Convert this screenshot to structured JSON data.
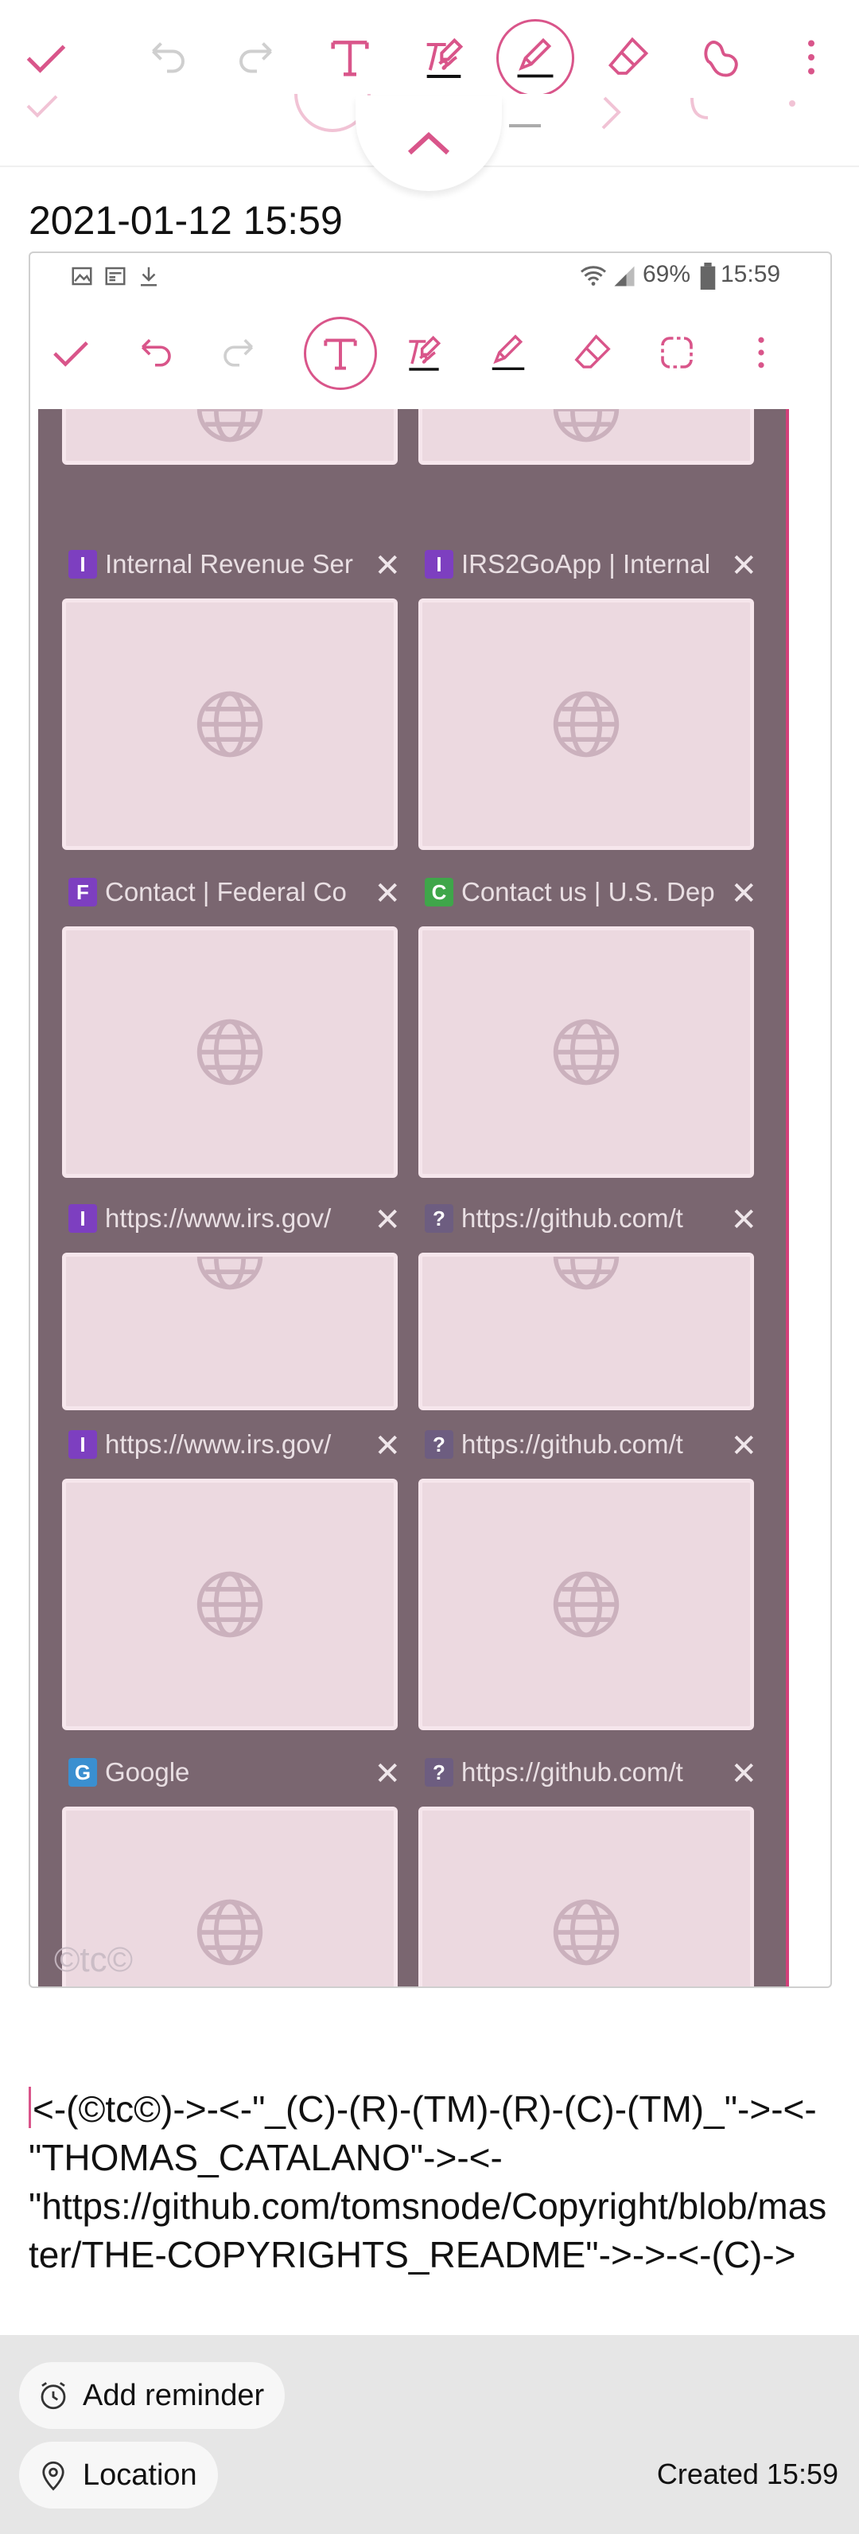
{
  "toolbar": {
    "buttons": [
      {
        "name": "done",
        "icon": "check-icon"
      },
      {
        "name": "undo",
        "icon": "undo-icon"
      },
      {
        "name": "redo",
        "icon": "redo-icon"
      },
      {
        "name": "text",
        "icon": "text-icon"
      },
      {
        "name": "handwriting",
        "icon": "handwriting-icon"
      },
      {
        "name": "pen",
        "icon": "pen-icon",
        "active": true
      },
      {
        "name": "eraser",
        "icon": "eraser-icon"
      },
      {
        "name": "selection",
        "icon": "lasso-icon"
      },
      {
        "name": "more",
        "icon": "more-vert-icon"
      }
    ],
    "accent": "#d9558a"
  },
  "note": {
    "timestamp": "2021-01-12 15:59",
    "body": "<-(©tc©)->-<-\"_(C)-(R)-(TM)-(R)-(C)-(TM)_\"->-<-\"THOMAS_CATALANO\"->-<-\"https://github.com/tomsnode/Copyright/blob/master/THE-COPYRIGHTS_README\"->->-<-(C)->"
  },
  "screenshot": {
    "status": {
      "battery": "69%",
      "time": "15:59"
    },
    "watermark": "©tc©",
    "tabs": [
      {
        "title": "Internal Revenue Ser",
        "favicon": "I",
        "favicon_color": "#7d3fc0"
      },
      {
        "title": "IRS2GoApp | Internal",
        "favicon": "I",
        "favicon_color": "#7d3fc0"
      },
      {
        "title": "Contact | Federal Co",
        "favicon": "F",
        "favicon_color": "#7d3fc0"
      },
      {
        "title": "Contact us | U.S. Dep",
        "favicon": "C",
        "favicon_color": "#3fa64a"
      },
      {
        "title": "https://www.irs.gov/",
        "favicon": "I",
        "favicon_color": "#7d3fc0"
      },
      {
        "title": "https://github.com/t",
        "favicon": "?",
        "favicon_color": "#6d5d80"
      },
      {
        "title": "https://www.irs.gov/",
        "favicon": "I",
        "favicon_color": "#7d3fc0"
      },
      {
        "title": "https://github.com/t",
        "favicon": "?",
        "favicon_color": "#6d5d80"
      },
      {
        "title": "Google",
        "favicon": "G",
        "favicon_color": "#3a8fd0"
      },
      {
        "title": "https://github.com/t",
        "favicon": "?",
        "favicon_color": "#6d5d80"
      }
    ]
  },
  "bottom": {
    "reminder_label": "Add reminder",
    "location_label": "Location",
    "created_label": "Created 15:59"
  }
}
